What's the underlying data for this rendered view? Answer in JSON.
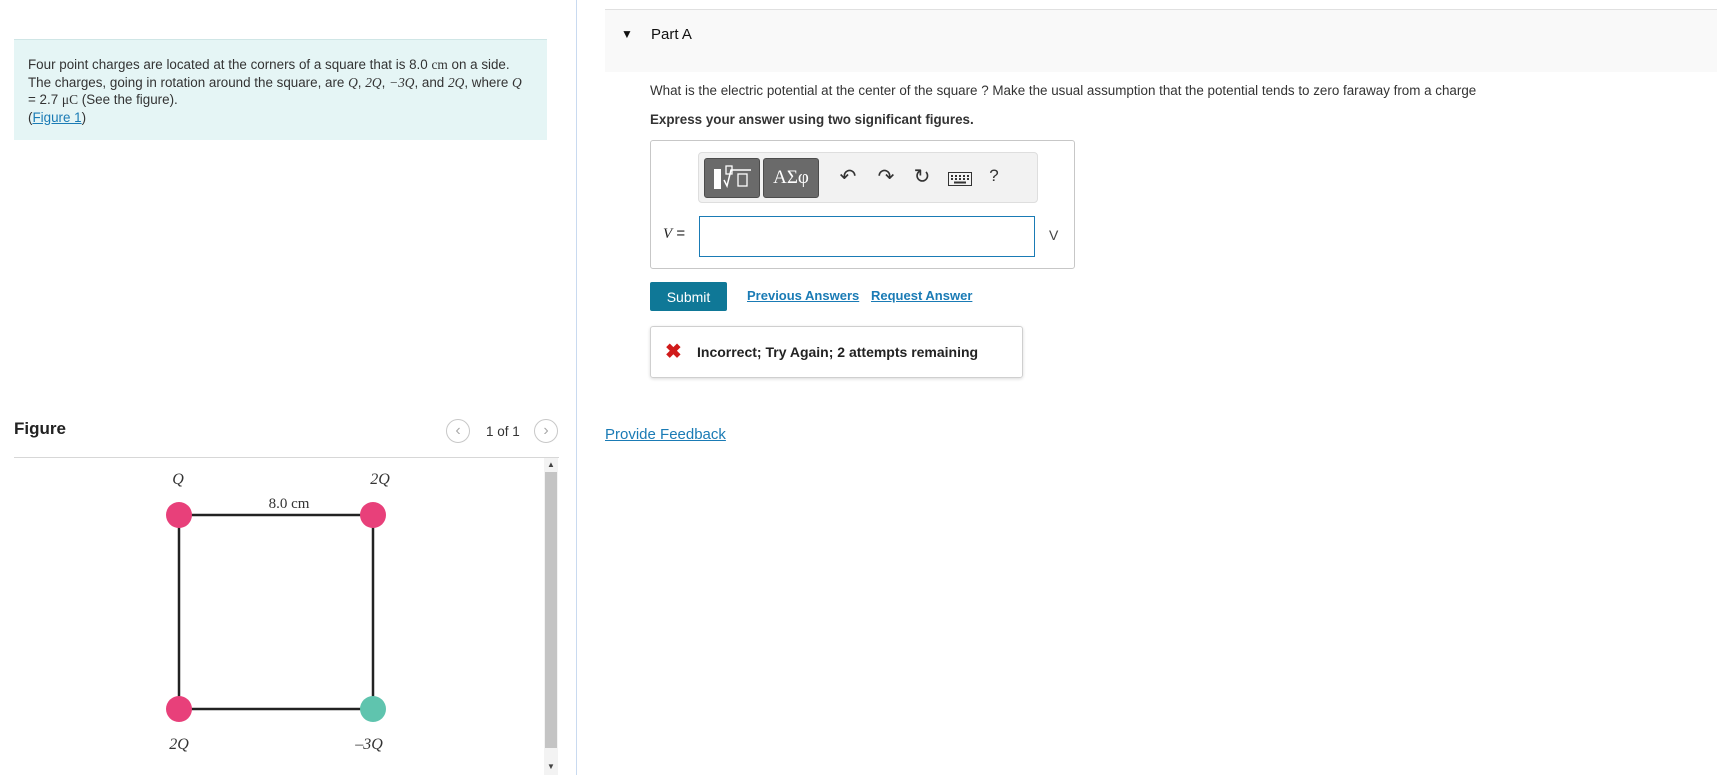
{
  "problem": {
    "text1": "Four point charges are located at the corners of a square that is 8.0 ",
    "unit_cm": "cm",
    "text2": " on a side. The charges, going in rotation around the square, are ",
    "q1": "Q",
    "q2": "2Q",
    "q3": "−3Q",
    "text_and": ", and ",
    "q4": "2Q",
    "text_where": ", where ",
    "qvar": "Q",
    "text_eq": " = 2.7 ",
    "unit_uc": "μC",
    "text_see": " (See the figure).",
    "figure_link": "Figure 1"
  },
  "figure_panel": {
    "title": "Figure",
    "prev_icon": "chevron-left-icon",
    "next_icon": "chevron-right-icon",
    "count": "1 of 1",
    "labels": {
      "top_left": "Q",
      "top_right": "2Q",
      "bottom_left": "2Q",
      "bottom_right": "–3Q",
      "side": "8.0 cm"
    },
    "colors": {
      "positive": "#e8407a",
      "negative": "#5fc4ae"
    }
  },
  "part": {
    "title": "Part A",
    "question": "What is the electric potential at the center of the square ?  Make the usual assumption that the potential tends to zero faraway from a charge",
    "instruction": "Express your answer using two significant figures.",
    "toolbar": {
      "templates_icon": "fraction-sqrt-icon",
      "symbols_label": "ΑΣφ",
      "undo_icon": "undo-icon",
      "redo_icon": "redo-icon",
      "reset_icon": "reset-icon",
      "keyboard_icon": "keyboard-icon",
      "help_label": "?"
    },
    "variable": "V",
    "equals": " =",
    "answer_value": "",
    "unit": "V",
    "submit_label": "Submit",
    "previous_answers": "Previous Answers",
    "request_answer": "Request Answer",
    "feedback": "Incorrect; Try Again; 2 attempts remaining"
  },
  "provide_feedback": "Provide Feedback",
  "colors": {
    "accent": "#0f7897",
    "link": "#1a7bb5",
    "error": "#d01a1a",
    "problem_bg": "#e5f5f5"
  }
}
